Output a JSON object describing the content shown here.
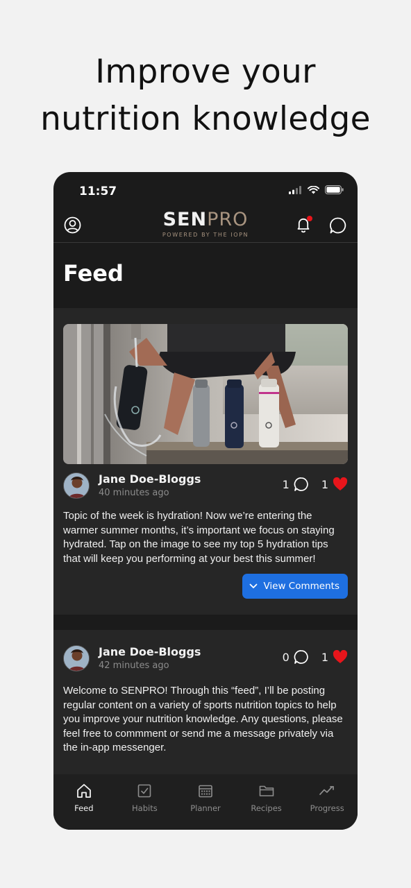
{
  "promo": {
    "headline_line1": "Improve your",
    "headline_line2": "nutrition knowledge"
  },
  "status_bar": {
    "time": "11:57"
  },
  "header": {
    "logo_sen": "SEN",
    "logo_pro": "PRO",
    "logo_tagline": "POWERED BY THE IOPN"
  },
  "page": {
    "title": "Feed"
  },
  "posts": [
    {
      "author": "Jane Doe-Bloggs",
      "time": "40 minutes ago",
      "comment_count": "1",
      "like_count": "1",
      "body": "Topic of the week is hydration! Now we’re entering the warmer summer months, it’s important we focus on staying hydrated. Tap on the image to see my top 5 hydration tips that will keep you performing at your best this summer!",
      "button_label": "View Comments"
    },
    {
      "author": "Jane Doe-Bloggs",
      "time": "42 minutes ago",
      "comment_count": "0",
      "like_count": "1",
      "body": "Welcome to SENPRO! Through this “feed”, I’ll be posting regular content on a variety of sports nutrition topics to help you improve your nutrition knowledge. Any questions, please feel free to commment or send me a message privately via the in-app messenger."
    }
  ],
  "tabs": [
    {
      "label": "Feed",
      "icon": "home-icon",
      "active": true
    },
    {
      "label": "Habits",
      "icon": "checkbox-icon"
    },
    {
      "label": "Planner",
      "icon": "calendar-icon"
    },
    {
      "label": "Recipes",
      "icon": "folder-icon"
    },
    {
      "label": "Progress",
      "icon": "trend-icon"
    }
  ],
  "colors": {
    "accent": "#1e6fe0",
    "heart": "#e8151b",
    "brand_gold": "#a89480",
    "notification_dot": "#e8151b"
  }
}
